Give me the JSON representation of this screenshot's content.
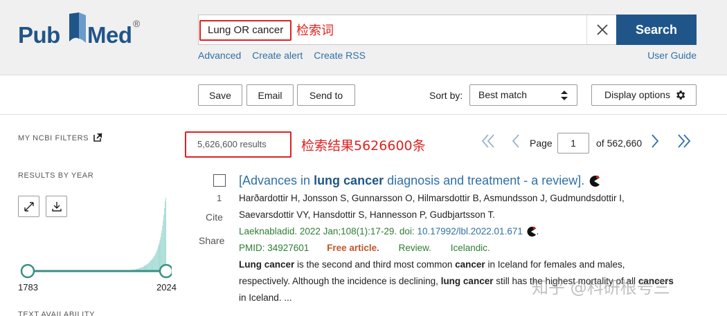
{
  "logo": {
    "left": "Pub",
    "right": "Med",
    "registered": "®"
  },
  "search": {
    "query": "Lung OR cancer",
    "annotation": "检索词",
    "button_label": "Search"
  },
  "sub_links": [
    "Advanced",
    "Create alert",
    "Create RSS"
  ],
  "user_guide": "User Guide",
  "toolbar": {
    "save_label": "Save",
    "email_label": "Email",
    "send_to_label": "Send to",
    "sort_label": "Sort by:",
    "sort_value": "Best match",
    "display_options_label": "Display options"
  },
  "sidebar": {
    "filters_title": "MY NCBI FILTERS",
    "results_by_year_title": "RESULTS BY YEAR",
    "year_start": "1783",
    "year_end": "2024",
    "text_availability_title": "TEXT AVAILABILITY"
  },
  "results": {
    "count_text": "5,626,600 results",
    "count_annotation": "检索结果5626600条",
    "page_label": "Page",
    "page_value": "1",
    "page_of": "of 562,660"
  },
  "result_item": {
    "number": "1",
    "cite_label": "Cite",
    "share_label": "Share",
    "title_before": "[Advances in ",
    "title_bold": "lung cancer",
    "title_after": " diagnosis and treatment - a review].",
    "authors_line1": "Harðardottir H, Jonsson S, Gunnarsson O, Hilmarsdottir B, Asmundsson J, Gudmundsdottir I,",
    "authors_line2": "Saevarsdottir VY, Hansdottir S, Hannesson P, Gudbjartsson T.",
    "citation": "Laeknabladid. 2022 Jan;108(1):17-29. doi: ",
    "doi": "10.17992/lbl.2022.01.671",
    "pmid": "PMID: 34927601",
    "free_article": "Free article.",
    "type": "Review.",
    "language": "Icelandic.",
    "snippet_1a": "Lung cancer",
    "snippet_1b": " is the second and third most common ",
    "snippet_1c": "cancer",
    "snippet_1d": " in Iceland for females and males,",
    "snippet_2a": "respectively. Although the incidence is declining, ",
    "snippet_2b": "lung cancer",
    "snippet_2c": " still has the highest mortality of all ",
    "snippet_2d": "cancers",
    "snippet_3": "in Iceland. ..."
  },
  "year_histogram": [
    0,
    0,
    0,
    0,
    0,
    0,
    0,
    0,
    0,
    0,
    0,
    0,
    0,
    0,
    0,
    0,
    0,
    0,
    0,
    0,
    0,
    0,
    0,
    0,
    0,
    0,
    0,
    0,
    0,
    0,
    0,
    0,
    0,
    0,
    0,
    0,
    0,
    0,
    0,
    0,
    0,
    0,
    0,
    0,
    0,
    0,
    0,
    0,
    0,
    0,
    0,
    0,
    0,
    0,
    0,
    0,
    0,
    0,
    0,
    0,
    0,
    0,
    0,
    0,
    0,
    0,
    0,
    0,
    0,
    0,
    0,
    0,
    0,
    0,
    0,
    0,
    0,
    0,
    0,
    0,
    0,
    0,
    0,
    0,
    0,
    0,
    0,
    0,
    0,
    0,
    0,
    0,
    0,
    0,
    0,
    0,
    0,
    0,
    0,
    0,
    0,
    0,
    0,
    0,
    0,
    0,
    0,
    0,
    0,
    0,
    0,
    0,
    0,
    0,
    0,
    0,
    0,
    0,
    0,
    0,
    0,
    0,
    0,
    0,
    0,
    0,
    0,
    0,
    0,
    0,
    0,
    0,
    0,
    0,
    0,
    0,
    0,
    0,
    0,
    0,
    0,
    0,
    0,
    0,
    0,
    0,
    0,
    0,
    0,
    1,
    1,
    1,
    1,
    1,
    1,
    1,
    1,
    1,
    2,
    2,
    2,
    2,
    2,
    2,
    3,
    3,
    3,
    3,
    4,
    4,
    4,
    5,
    5,
    5,
    6,
    6,
    7,
    7,
    8,
    8,
    9,
    10,
    10,
    11,
    12,
    13,
    14,
    15,
    16,
    17,
    18,
    20,
    21,
    23,
    25,
    27,
    29,
    32,
    35,
    38,
    42,
    46,
    51,
    56,
    62,
    69,
    77,
    86,
    96,
    100
  ],
  "watermark": "知乎 @科研根号三",
  "colors": {
    "brand": "#20558a",
    "link": "#2f6fa7",
    "annotation": "#e02020",
    "green": "#2e7d32",
    "free": "#c0552a"
  }
}
